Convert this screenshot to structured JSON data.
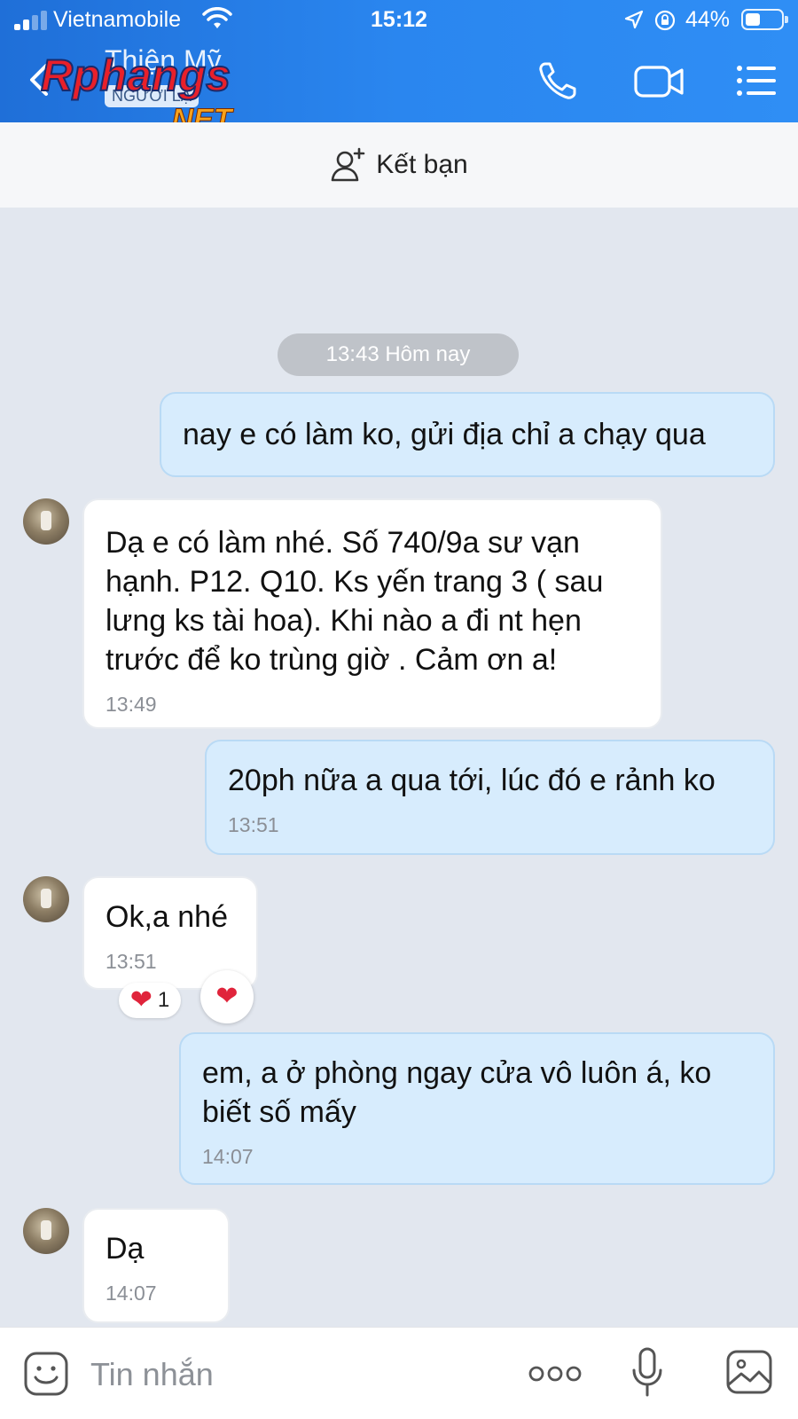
{
  "status_bar": {
    "carrier": "Vietnamobile",
    "time": "15:12",
    "battery": "44%"
  },
  "header": {
    "contact_name": "Thiện Mỹ",
    "contact_status": "NGƯỜI LẠ",
    "watermark": "Rphangs .NET"
  },
  "friend_bar": {
    "add_friend_label": "Kết bạn"
  },
  "conversation": {
    "date_divider": "13:43 Hôm nay",
    "messages": [
      {
        "direction": "out",
        "text": "nay e có làm ko, gửi địa chỉ a chạy qua",
        "time": ""
      },
      {
        "direction": "in",
        "text": "Dạ e có làm nhé. Số 740/9a sư vạn hạnh. P12. Q10. Ks yến trang 3 ( sau lưng ks tài hoa). Khi nào a đi nt hẹn trước để ko trùng giờ . Cảm ơn a!",
        "time": "13:49"
      },
      {
        "direction": "out",
        "text": "20ph nữa a qua tới, lúc đó e rảnh ko",
        "time": "13:51"
      },
      {
        "direction": "in",
        "text": "Ok,a nhé",
        "time": "13:51",
        "reaction": {
          "emoji": "❤",
          "count": "1"
        }
      },
      {
        "direction": "out",
        "text": "em, a ở phòng ngay cửa vô luôn á, ko biết số mấy",
        "time": "14:07"
      },
      {
        "direction": "in",
        "text": "Dạ",
        "time": "14:07"
      }
    ],
    "reaction_button_emoji": "❤"
  },
  "input_bar": {
    "placeholder": "Tin nhắn"
  },
  "icons": {
    "back": "back-arrow-icon",
    "call": "phone-icon",
    "video": "video-camera-icon",
    "menu": "list-menu-icon",
    "add_friend": "add-user-icon",
    "emoji": "sticker-icon",
    "more": "more-dots-icon",
    "mic": "microphone-icon",
    "image": "image-icon"
  },
  "colors": {
    "header_blue": "#2a86ef",
    "outgoing_bubble": "#d7ecfd",
    "incoming_bubble": "#ffffff",
    "chat_background": "#e2e7ef",
    "heart_red": "#e0243b"
  }
}
